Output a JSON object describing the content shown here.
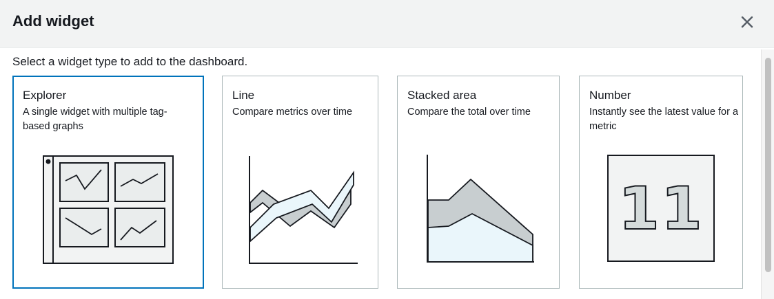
{
  "modal": {
    "title": "Add widget",
    "close_icon": "close-icon"
  },
  "intro_text": "Select a widget type to add to the dashboard.",
  "widgets": [
    {
      "title": "Explorer",
      "description": "A single widget with multiple tag-based graphs",
      "selected": true,
      "icon": "explorer-grid-icon"
    },
    {
      "title": "Line",
      "description": "Compare metrics over time",
      "selected": false,
      "icon": "line-chart-icon"
    },
    {
      "title": "Stacked area",
      "description": "Compare the total over time",
      "selected": false,
      "icon": "stacked-area-chart-icon"
    },
    {
      "title": "Number",
      "description": "Instantly see the latest value for a metric",
      "selected": false,
      "icon": "number-icon"
    }
  ],
  "number_preview_value": "11",
  "colors": {
    "selected_border": "#0073bb",
    "card_border": "#aab7b8",
    "illustration_gray": "#d5dbdb",
    "illustration_blue": "#eaf6fb"
  }
}
